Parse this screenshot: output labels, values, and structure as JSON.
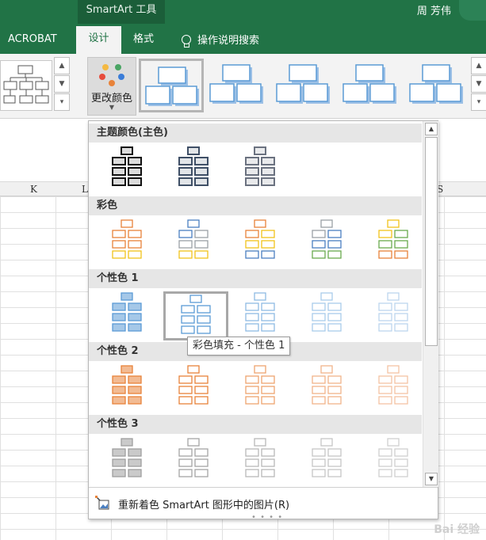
{
  "titlebar": {
    "context_tab": "SmartArt 工具",
    "user_name": "周 芳伟"
  },
  "tabs": [
    {
      "label": "ACROBAT"
    },
    {
      "label": "设计"
    },
    {
      "label": "格式"
    },
    {
      "label": "操作说明搜索"
    }
  ],
  "ribbon": {
    "change_colors_label": "更改颜色",
    "selected_style_index": 0,
    "dot_colors": [
      "#f4b942",
      "#4aa564",
      "#e74c3c",
      "#3b7dd8",
      "#e8833a"
    ]
  },
  "columns": [
    "K",
    "L",
    "S"
  ],
  "dropdown": {
    "sections": [
      {
        "title": "主题颜色(主色)",
        "palettes": [
          [
            "#111111",
            "#111111",
            "#111111"
          ],
          [
            "#3f4f66",
            "#3f4f66",
            "#3f4f66"
          ],
          [
            "#6b7280",
            "#6b7280",
            "#6b7280"
          ]
        ],
        "filled": true
      },
      {
        "title": "彩色",
        "palettes": [
          [
            "#e8833a",
            "#e8833a",
            "#f2c21b"
          ],
          [
            "#4a7fc1",
            "#9aa0a6",
            "#f2c21b"
          ],
          [
            "#e8833a",
            "#f2c21b",
            "#4a7fc1"
          ],
          [
            "#9aa0a6",
            "#4a7fc1",
            "#6aaa4e"
          ],
          [
            "#f2c21b",
            "#6aaa4e",
            "#e8833a"
          ]
        ],
        "filled": false
      },
      {
        "title": "个性色 1",
        "palettes": [
          [
            "#5b9bd5",
            "#5b9bd5",
            "#5b9bd5"
          ],
          [
            "#5b9bd5",
            "#5b9bd5",
            "#5b9bd5"
          ],
          [
            "#8fbbe3",
            "#8fbbe3",
            "#8fbbe3"
          ],
          [
            "#a9cbea",
            "#a9cbea",
            "#a9cbea"
          ],
          [
            "#bcd6ef",
            "#bcd6ef",
            "#bcd6ef"
          ]
        ],
        "filled": false
      },
      {
        "title": "个性色 2",
        "palettes": [
          [
            "#e8833a",
            "#e8833a",
            "#e8833a"
          ],
          [
            "#e8833a",
            "#e8833a",
            "#e8833a"
          ],
          [
            "#eea46f",
            "#eea46f",
            "#eea46f"
          ],
          [
            "#f1b48a",
            "#f1b48a",
            "#f1b48a"
          ],
          [
            "#f4c4a3",
            "#f4c4a3",
            "#f4c4a3"
          ]
        ],
        "filled": false
      },
      {
        "title": "个性色 3",
        "palettes": [
          [
            "#9e9e9e",
            "#9e9e9e",
            "#9e9e9e"
          ],
          [
            "#a5a5a5",
            "#a5a5a5",
            "#a5a5a5"
          ],
          [
            "#b8b8b8",
            "#b8b8b8",
            "#b8b8b8"
          ],
          [
            "#c5c5c5",
            "#c5c5c5",
            "#c5c5c5"
          ],
          [
            "#d0d0d0",
            "#d0d0d0",
            "#d0d0d0"
          ]
        ],
        "filled": false
      }
    ],
    "tooltip": "彩色填充 - 个性色 1",
    "footer_label": "重新着色 SmartArt 图形中的图片(R)"
  },
  "watermark": "Bai 经验"
}
